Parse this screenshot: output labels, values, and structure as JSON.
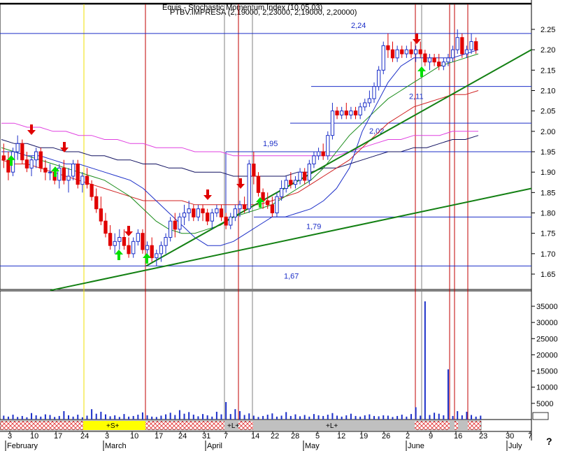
{
  "header": {
    "title_line1": "Equis - Stochastic Momentum Index (10,05,03)",
    "title_line2": "PTBV.IMPRESA (2,19000, 2,23000, 2,19000, 2,20000)"
  },
  "help_glyph": "?",
  "colors": {
    "up_candle": "#1c2fc8",
    "down_candle": "#e00000",
    "ma_fast": "#1c2fc8",
    "ma_green": "#1a8c1a",
    "ma_red": "#d02020",
    "ma_magenta": "#e040e0",
    "ma_navy": "#101060",
    "trendline": "#138013",
    "level_line": "#1c2fc8",
    "volume": "#1c2fc8",
    "buy_arrow": "#00e000",
    "sell_arrow": "#e00000",
    "band_neutral": "#c0c0c0",
    "band_short": "#ffff00"
  },
  "chart_data": {
    "type": "candlestick",
    "price_axis": {
      "ticks": [
        "2.25",
        "2.20",
        "2.15",
        "2.10",
        "2.05",
        "2.00",
        "1.95",
        "1.90",
        "1.85",
        "1.80",
        "1.75",
        "1.70",
        "1.65"
      ],
      "range": [
        1.61,
        2.31
      ]
    },
    "volume_axis": {
      "ticks": [
        "35000",
        "30000",
        "25000",
        "20000",
        "15000",
        "10000",
        "5000"
      ],
      "range": [
        0,
        40000
      ]
    },
    "date_ticks": [
      "3",
      "10",
      "17",
      "24",
      "3",
      "10",
      "17",
      "24",
      "31",
      "7",
      "14",
      "22",
      "28",
      "5",
      "12",
      "19",
      "26",
      "2",
      "9",
      "16",
      "23",
      "30",
      "7"
    ],
    "months": [
      "February",
      "March",
      "April",
      "May",
      "June",
      "July"
    ],
    "levels": [
      {
        "label": "2,24",
        "value": 2.24
      },
      {
        "label": "2,11",
        "value": 2.11
      },
      {
        "label": "2,02",
        "value": 2.02
      },
      {
        "label": "1,95",
        "value": 1.95
      },
      {
        "label": "1,79",
        "value": 1.79
      },
      {
        "label": "1,67",
        "value": 1.67
      }
    ],
    "signal_bands": [
      {
        "label": "+S+",
        "kind": "short"
      },
      {
        "label": "+L+",
        "kind": "long"
      },
      {
        "label": "+L+",
        "kind": "long"
      }
    ],
    "candles": [
      [
        1.94,
        1.97,
        1.91,
        1.93
      ],
      [
        1.93,
        1.95,
        1.88,
        1.9
      ],
      [
        1.9,
        1.96,
        1.89,
        1.95
      ],
      [
        1.95,
        1.99,
        1.93,
        1.97
      ],
      [
        1.97,
        1.98,
        1.92,
        1.93
      ],
      [
        1.93,
        1.95,
        1.9,
        1.91
      ],
      [
        1.91,
        1.94,
        1.89,
        1.93
      ],
      [
        1.93,
        1.96,
        1.91,
        1.95
      ],
      [
        1.95,
        1.96,
        1.9,
        1.91
      ],
      [
        1.91,
        1.93,
        1.88,
        1.9
      ],
      [
        1.9,
        1.92,
        1.88,
        1.9
      ],
      [
        1.9,
        1.91,
        1.87,
        1.88
      ],
      [
        1.88,
        1.92,
        1.86,
        1.91
      ],
      [
        1.91,
        1.93,
        1.87,
        1.88
      ],
      [
        1.88,
        1.91,
        1.85,
        1.89
      ],
      [
        1.89,
        1.93,
        1.88,
        1.92
      ],
      [
        1.92,
        1.93,
        1.86,
        1.87
      ],
      [
        1.87,
        1.9,
        1.85,
        1.89
      ],
      [
        1.89,
        1.91,
        1.86,
        1.87
      ],
      [
        1.87,
        1.88,
        1.83,
        1.84
      ],
      [
        1.84,
        1.86,
        1.8,
        1.81
      ],
      [
        1.81,
        1.84,
        1.77,
        1.78
      ],
      [
        1.78,
        1.8,
        1.74,
        1.75
      ],
      [
        1.75,
        1.77,
        1.71,
        1.72
      ],
      [
        1.72,
        1.75,
        1.7,
        1.73
      ],
      [
        1.73,
        1.76,
        1.71,
        1.74
      ],
      [
        1.74,
        1.76,
        1.71,
        1.72
      ],
      [
        1.72,
        1.74,
        1.69,
        1.7
      ],
      [
        1.7,
        1.74,
        1.69,
        1.73
      ],
      [
        1.73,
        1.76,
        1.72,
        1.75
      ],
      [
        1.75,
        1.76,
        1.7,
        1.71
      ],
      [
        1.71,
        1.73,
        1.69,
        1.72
      ],
      [
        1.72,
        1.74,
        1.68,
        1.69
      ],
      [
        1.69,
        1.71,
        1.67,
        1.7
      ],
      [
        1.7,
        1.73,
        1.68,
        1.72
      ],
      [
        1.72,
        1.75,
        1.7,
        1.74
      ],
      [
        1.74,
        1.79,
        1.73,
        1.78
      ],
      [
        1.78,
        1.8,
        1.74,
        1.76
      ],
      [
        1.76,
        1.8,
        1.75,
        1.79
      ],
      [
        1.79,
        1.82,
        1.77,
        1.8
      ],
      [
        1.8,
        1.83,
        1.78,
        1.81
      ],
      [
        1.81,
        1.82,
        1.78,
        1.79
      ],
      [
        1.79,
        1.82,
        1.78,
        1.81
      ],
      [
        1.81,
        1.82,
        1.78,
        1.8
      ],
      [
        1.8,
        1.81,
        1.77,
        1.78
      ],
      [
        1.78,
        1.81,
        1.76,
        1.8
      ],
      [
        1.8,
        1.82,
        1.79,
        1.81
      ],
      [
        1.81,
        1.82,
        1.78,
        1.79
      ],
      [
        1.79,
        1.8,
        1.76,
        1.77
      ],
      [
        1.77,
        1.8,
        1.76,
        1.79
      ],
      [
        1.79,
        1.82,
        1.78,
        1.81
      ],
      [
        1.81,
        1.83,
        1.79,
        1.82
      ],
      [
        1.82,
        1.84,
        1.8,
        1.81
      ],
      [
        1.81,
        1.93,
        1.8,
        1.92
      ],
      [
        1.92,
        1.95,
        1.87,
        1.89
      ],
      [
        1.89,
        1.9,
        1.84,
        1.85
      ],
      [
        1.85,
        1.86,
        1.81,
        1.83
      ],
      [
        1.83,
        1.85,
        1.81,
        1.82
      ],
      [
        1.82,
        1.84,
        1.79,
        1.8
      ],
      [
        1.8,
        1.85,
        1.79,
        1.84
      ],
      [
        1.84,
        1.88,
        1.83,
        1.86
      ],
      [
        1.86,
        1.89,
        1.85,
        1.88
      ],
      [
        1.88,
        1.9,
        1.86,
        1.87
      ],
      [
        1.87,
        1.89,
        1.86,
        1.88
      ],
      [
        1.88,
        1.91,
        1.87,
        1.9
      ],
      [
        1.9,
        1.91,
        1.87,
        1.88
      ],
      [
        1.88,
        1.93,
        1.87,
        1.92
      ],
      [
        1.92,
        1.95,
        1.91,
        1.94
      ],
      [
        1.94,
        1.96,
        1.93,
        1.95
      ],
      [
        1.95,
        1.97,
        1.93,
        1.94
      ],
      [
        1.94,
        2.0,
        1.93,
        1.99
      ],
      [
        1.99,
        2.07,
        1.98,
        2.05
      ],
      [
        2.05,
        2.06,
        2.03,
        2.04
      ],
      [
        2.04,
        2.06,
        2.03,
        2.05
      ],
      [
        2.05,
        2.07,
        2.03,
        2.04
      ],
      [
        2.04,
        2.06,
        2.03,
        2.05
      ],
      [
        2.05,
        2.06,
        2.03,
        2.04
      ],
      [
        2.04,
        2.07,
        2.03,
        2.06
      ],
      [
        2.06,
        2.08,
        2.05,
        2.07
      ],
      [
        2.07,
        2.1,
        2.06,
        2.08
      ],
      [
        2.08,
        2.12,
        2.07,
        2.11
      ],
      [
        2.11,
        2.16,
        2.1,
        2.15
      ],
      [
        2.15,
        2.22,
        2.14,
        2.21
      ],
      [
        2.21,
        2.24,
        2.18,
        2.2
      ],
      [
        2.2,
        2.22,
        2.17,
        2.18
      ],
      [
        2.18,
        2.21,
        2.17,
        2.2
      ],
      [
        2.2,
        2.21,
        2.18,
        2.19
      ],
      [
        2.19,
        2.21,
        2.18,
        2.2
      ],
      [
        2.2,
        2.22,
        2.18,
        2.19
      ],
      [
        2.19,
        2.21,
        2.17,
        2.2
      ],
      [
        2.2,
        2.22,
        2.18,
        2.19
      ],
      [
        2.19,
        2.2,
        2.16,
        2.17
      ],
      [
        2.17,
        2.19,
        2.15,
        2.18
      ],
      [
        2.18,
        2.19,
        2.16,
        2.17
      ],
      [
        2.17,
        2.19,
        2.15,
        2.16
      ],
      [
        2.16,
        2.18,
        2.15,
        2.17
      ],
      [
        2.17,
        2.19,
        2.16,
        2.18
      ],
      [
        2.18,
        2.21,
        2.17,
        2.2
      ],
      [
        2.2,
        2.25,
        2.19,
        2.23
      ],
      [
        2.23,
        2.24,
        2.18,
        2.19
      ],
      [
        2.19,
        2.21,
        2.18,
        2.2
      ],
      [
        2.2,
        2.24,
        2.19,
        2.22
      ],
      [
        2.22,
        2.23,
        2.19,
        2.2
      ]
    ],
    "ma_fast": [
      1.95,
      1.95,
      1.94,
      1.94,
      1.93,
      1.92,
      1.92,
      1.91,
      1.9,
      1.89,
      1.88,
      1.86,
      1.83,
      1.8,
      1.77,
      1.74,
      1.72,
      1.72,
      1.73,
      1.75,
      1.77,
      1.79,
      1.79,
      1.8,
      1.81,
      1.83,
      1.86,
      1.91,
      2.0,
      2.06,
      2.12,
      2.16,
      2.18,
      2.18,
      2.18,
      2.18,
      2.19,
      2.2
    ],
    "ma_green": [
      1.96,
      1.95,
      1.94,
      1.93,
      1.92,
      1.91,
      1.9,
      1.89,
      1.88,
      1.86,
      1.84,
      1.81,
      1.78,
      1.76,
      1.75,
      1.75,
      1.76,
      1.77,
      1.79,
      1.8,
      1.81,
      1.82,
      1.84,
      1.86,
      1.88,
      1.91,
      1.95,
      1.99,
      2.02,
      2.05,
      2.08,
      2.1,
      2.12,
      2.14,
      2.16,
      2.17,
      2.18,
      2.19
    ],
    "ma_red": [
      1.93,
      1.92,
      1.92,
      1.91,
      1.9,
      1.89,
      1.88,
      1.87,
      1.86,
      1.85,
      1.84,
      1.83,
      1.83,
      1.83,
      1.83,
      1.82,
      1.82,
      1.82,
      1.82,
      1.82,
      1.82,
      1.83,
      1.84,
      1.85,
      1.87,
      1.89,
      1.91,
      1.93,
      1.96,
      1.99,
      2.02,
      2.04,
      2.06,
      2.07,
      2.08,
      2.09,
      2.09,
      2.1
    ],
    "ma_magenta": [
      2.02,
      2.02,
      2.01,
      2.01,
      2.0,
      2.0,
      1.99,
      1.99,
      1.98,
      1.98,
      1.97,
      1.97,
      1.96,
      1.96,
      1.96,
      1.95,
      1.95,
      1.95,
      1.94,
      1.94,
      1.94,
      1.94,
      1.94,
      1.94,
      1.94,
      1.94,
      1.94,
      1.95,
      1.96,
      1.97,
      1.98,
      1.98,
      1.99,
      1.99,
      1.99,
      2.0,
      2.0,
      2.0
    ],
    "ma_navy": [
      1.98,
      1.97,
      1.97,
      1.96,
      1.96,
      1.95,
      1.95,
      1.94,
      1.94,
      1.93,
      1.93,
      1.92,
      1.92,
      1.91,
      1.91,
      1.9,
      1.9,
      1.9,
      1.89,
      1.89,
      1.89,
      1.89,
      1.89,
      1.9,
      1.9,
      1.91,
      1.91,
      1.92,
      1.93,
      1.94,
      1.95,
      1.95,
      1.96,
      1.96,
      1.97,
      1.98,
      1.98,
      1.99
    ],
    "volume": [
      1200,
      900,
      1500,
      800,
      1100,
      700,
      2000,
      1300,
      900,
      1600,
      1400,
      800,
      1100,
      2600,
      1300,
      900,
      1500,
      700,
      1200,
      3200,
      1800,
      2400,
      1600,
      1000,
      1300,
      800,
      1700,
      900,
      1100,
      1500,
      2200,
      1300,
      900,
      800,
      1200,
      1600,
      2100,
      1400,
      2900,
      1800,
      2300,
      1500,
      1000,
      1700,
      1300,
      900,
      2400,
      1600,
      5400,
      1700,
      3200,
      2600,
      1400,
      1900,
      1200,
      800,
      1100,
      1500,
      1900,
      900,
      1200,
      2300,
      1100,
      1600,
      1000,
      1400,
      900,
      1700,
      1300,
      1100,
      1500,
      2000,
      1200,
      900,
      1300,
      1800,
      1100,
      900,
      1300,
      1600,
      1100,
      1000,
      1300,
      1200,
      800,
      1100,
      1500,
      900,
      1700,
      3800,
      1200,
      36500,
      1400,
      2100,
      1800,
      1300,
      15500,
      1100,
      2600,
      1300,
      2400,
      1400,
      900,
      1200
    ],
    "buy_signal_dates": [
      "Feb 3",
      "Feb 17",
      "Mar 10",
      "Mar 14",
      "Apr 14",
      "Jun 9"
    ],
    "sell_signal_dates": [
      "Feb 10",
      "Feb 22",
      "Mar 10",
      "Apr 1",
      "Apr 10",
      "Jun 2"
    ]
  }
}
